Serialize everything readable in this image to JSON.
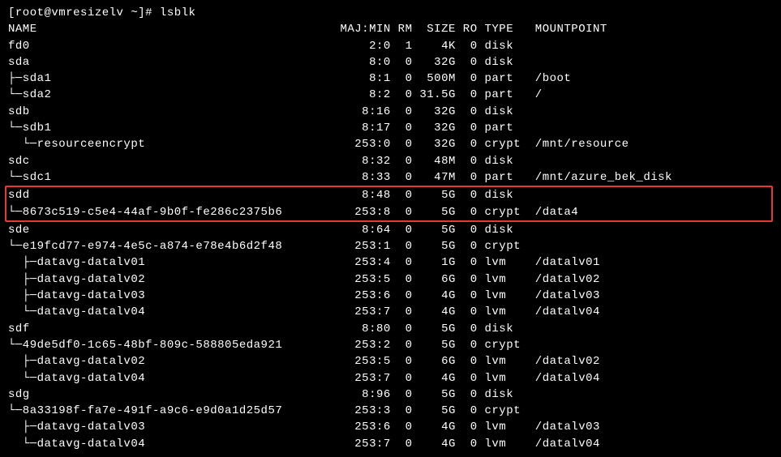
{
  "prompt": "[root@vmresizelv ~]# ",
  "command": "lsblk",
  "header": {
    "name": "NAME",
    "majmin": "MAJ:MIN",
    "rm": "RM",
    "size": "SIZE",
    "ro": "RO",
    "type": "TYPE",
    "mount": "MOUNTPOINT"
  },
  "rows": [
    {
      "indent": 0,
      "pipe": "",
      "name": "fd0",
      "majmin": "2:0",
      "rm": "1",
      "size": "4K",
      "ro": "0",
      "type": "disk",
      "mount": "",
      "hl": false
    },
    {
      "indent": 0,
      "pipe": "",
      "name": "sda",
      "majmin": "8:0",
      "rm": "0",
      "size": "32G",
      "ro": "0",
      "type": "disk",
      "mount": "",
      "hl": false
    },
    {
      "indent": 0,
      "pipe": "├─",
      "name": "sda1",
      "majmin": "8:1",
      "rm": "0",
      "size": "500M",
      "ro": "0",
      "type": "part",
      "mount": "/boot",
      "hl": false
    },
    {
      "indent": 0,
      "pipe": "└─",
      "name": "sda2",
      "majmin": "8:2",
      "rm": "0",
      "size": "31.5G",
      "ro": "0",
      "type": "part",
      "mount": "/",
      "hl": false
    },
    {
      "indent": 0,
      "pipe": "",
      "name": "sdb",
      "majmin": "8:16",
      "rm": "0",
      "size": "32G",
      "ro": "0",
      "type": "disk",
      "mount": "",
      "hl": false
    },
    {
      "indent": 0,
      "pipe": "└─",
      "name": "sdb1",
      "majmin": "8:17",
      "rm": "0",
      "size": "32G",
      "ro": "0",
      "type": "part",
      "mount": "",
      "hl": false
    },
    {
      "indent": 1,
      "pipe": "└─",
      "name": "resourceencrypt",
      "majmin": "253:0",
      "rm": "0",
      "size": "32G",
      "ro": "0",
      "type": "crypt",
      "mount": "/mnt/resource",
      "hl": false
    },
    {
      "indent": 0,
      "pipe": "",
      "name": "sdc",
      "majmin": "8:32",
      "rm": "0",
      "size": "48M",
      "ro": "0",
      "type": "disk",
      "mount": "",
      "hl": false
    },
    {
      "indent": 0,
      "pipe": "└─",
      "name": "sdc1",
      "majmin": "8:33",
      "rm": "0",
      "size": "47M",
      "ro": "0",
      "type": "part",
      "mount": "/mnt/azure_bek_disk",
      "hl": false
    },
    {
      "indent": 0,
      "pipe": "",
      "name": "sdd",
      "majmin": "8:48",
      "rm": "0",
      "size": "5G",
      "ro": "0",
      "type": "disk",
      "mount": "",
      "hl": true
    },
    {
      "indent": 0,
      "pipe": "└─",
      "name": "8673c519-c5e4-44af-9b0f-fe286c2375b6",
      "majmin": "253:8",
      "rm": "0",
      "size": "5G",
      "ro": "0",
      "type": "crypt",
      "mount": "/data4",
      "hl": true
    },
    {
      "indent": 0,
      "pipe": "",
      "name": "sde",
      "majmin": "8:64",
      "rm": "0",
      "size": "5G",
      "ro": "0",
      "type": "disk",
      "mount": "",
      "hl": false
    },
    {
      "indent": 0,
      "pipe": "└─",
      "name": "e19fcd77-e974-4e5c-a874-e78e4b6d2f48",
      "majmin": "253:1",
      "rm": "0",
      "size": "5G",
      "ro": "0",
      "type": "crypt",
      "mount": "",
      "hl": false
    },
    {
      "indent": 1,
      "pipe": "├─",
      "name": "datavg-datalv01",
      "majmin": "253:4",
      "rm": "0",
      "size": "1G",
      "ro": "0",
      "type": "lvm",
      "mount": "/datalv01",
      "hl": false
    },
    {
      "indent": 1,
      "pipe": "├─",
      "name": "datavg-datalv02",
      "majmin": "253:5",
      "rm": "0",
      "size": "6G",
      "ro": "0",
      "type": "lvm",
      "mount": "/datalv02",
      "hl": false
    },
    {
      "indent": 1,
      "pipe": "├─",
      "name": "datavg-datalv03",
      "majmin": "253:6",
      "rm": "0",
      "size": "4G",
      "ro": "0",
      "type": "lvm",
      "mount": "/datalv03",
      "hl": false
    },
    {
      "indent": 1,
      "pipe": "└─",
      "name": "datavg-datalv04",
      "majmin": "253:7",
      "rm": "0",
      "size": "4G",
      "ro": "0",
      "type": "lvm",
      "mount": "/datalv04",
      "hl": false
    },
    {
      "indent": 0,
      "pipe": "",
      "name": "sdf",
      "majmin": "8:80",
      "rm": "0",
      "size": "5G",
      "ro": "0",
      "type": "disk",
      "mount": "",
      "hl": false
    },
    {
      "indent": 0,
      "pipe": "└─",
      "name": "49de5df0-1c65-48bf-809c-588805eda921",
      "majmin": "253:2",
      "rm": "0",
      "size": "5G",
      "ro": "0",
      "type": "crypt",
      "mount": "",
      "hl": false
    },
    {
      "indent": 1,
      "pipe": "├─",
      "name": "datavg-datalv02",
      "majmin": "253:5",
      "rm": "0",
      "size": "6G",
      "ro": "0",
      "type": "lvm",
      "mount": "/datalv02",
      "hl": false
    },
    {
      "indent": 1,
      "pipe": "└─",
      "name": "datavg-datalv04",
      "majmin": "253:7",
      "rm": "0",
      "size": "4G",
      "ro": "0",
      "type": "lvm",
      "mount": "/datalv04",
      "hl": false
    },
    {
      "indent": 0,
      "pipe": "",
      "name": "sdg",
      "majmin": "8:96",
      "rm": "0",
      "size": "5G",
      "ro": "0",
      "type": "disk",
      "mount": "",
      "hl": false
    },
    {
      "indent": 0,
      "pipe": "└─",
      "name": "8a33198f-fa7e-491f-a9c6-e9d0a1d25d57",
      "majmin": "253:3",
      "rm": "0",
      "size": "5G",
      "ro": "0",
      "type": "crypt",
      "mount": "",
      "hl": false
    },
    {
      "indent": 1,
      "pipe": "├─",
      "name": "datavg-datalv03",
      "majmin": "253:6",
      "rm": "0",
      "size": "4G",
      "ro": "0",
      "type": "lvm",
      "mount": "/datalv03",
      "hl": false
    },
    {
      "indent": 1,
      "pipe": "└─",
      "name": "datavg-datalv04",
      "majmin": "253:7",
      "rm": "0",
      "size": "4G",
      "ro": "0",
      "type": "lvm",
      "mount": "/datalv04",
      "hl": false
    }
  ],
  "cols": {
    "name_w": 45,
    "majmin_w": 8,
    "rm_w": 3,
    "size_w": 6,
    "ro_w": 3,
    "type_w": 7
  }
}
